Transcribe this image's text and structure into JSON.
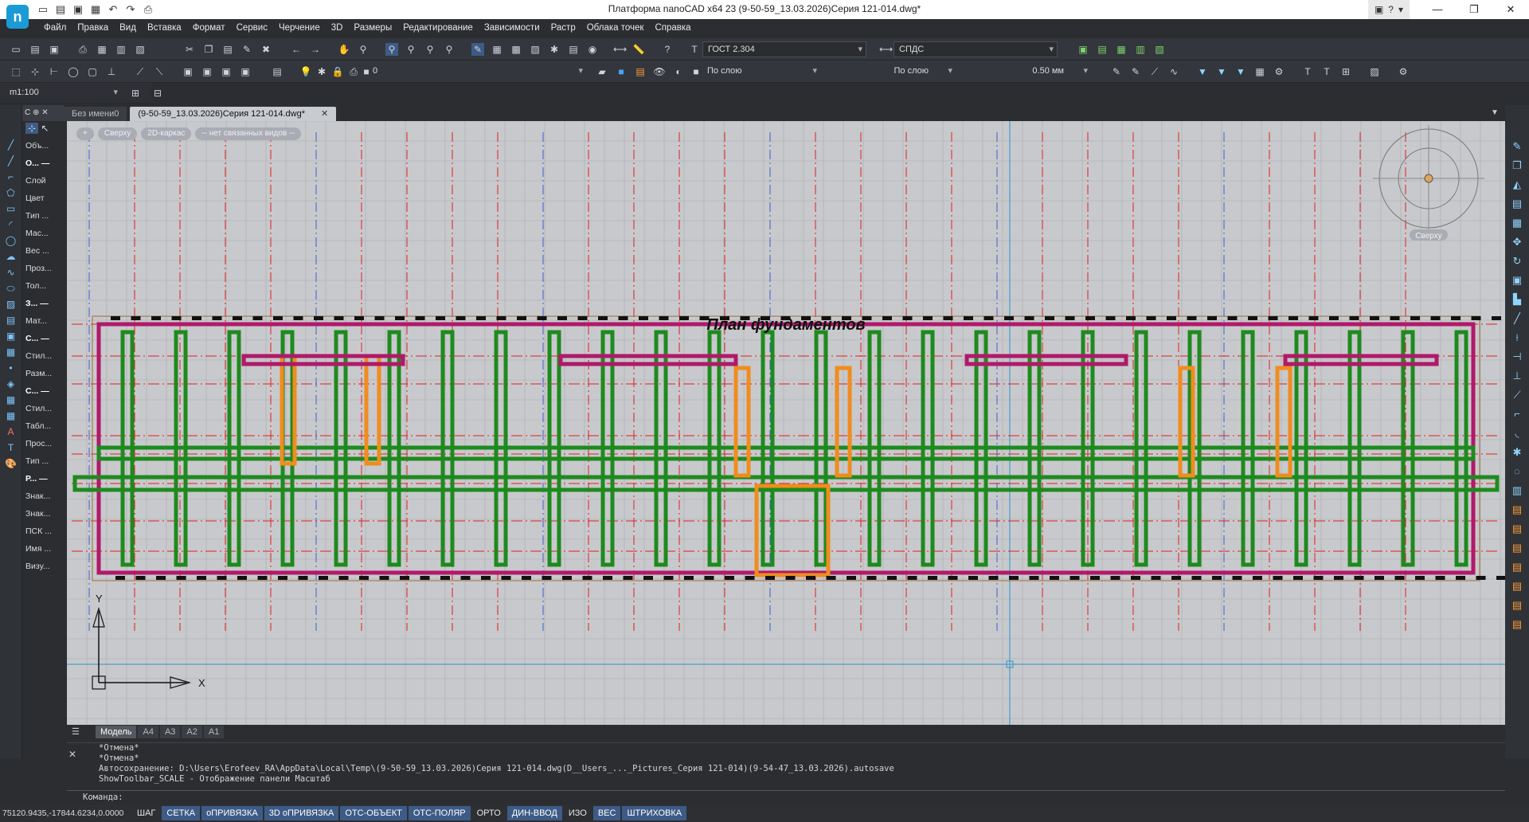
{
  "app": {
    "title": "Платформа nanoCAD x64 23 (9-50-59_13.03.2026)Серия 121-014.dwg*",
    "logo": "n"
  },
  "menu": [
    "Файл",
    "Правка",
    "Вид",
    "Вставка",
    "Формат",
    "Сервис",
    "Черчение",
    "3D",
    "Размеры",
    "Редактирование",
    "Зависимости",
    "Растр",
    "Облака точек",
    "Справка"
  ],
  "toolbar": {
    "text_style": "ГОСТ 2.304",
    "dim_style": "СПДС",
    "layer": "0",
    "color": "По слою",
    "linetype": "По слою",
    "lineweight": "0.50 мм",
    "scale": "m1:100"
  },
  "properties_panel": {
    "header": "С",
    "rows": [
      "Объ...",
      "О... —",
      "Слой",
      "Цвет",
      "Тип ...",
      "Мас...",
      "Вес ...",
      "Проз...",
      "Тол...",
      "З... —",
      "Мат...",
      "С... —",
      "Стил...",
      "Разм...",
      "С... —",
      "Стил...",
      "Табл...",
      "Прос...",
      "Тип ...",
      "Р... —",
      "Знак...",
      "Знак...",
      "ПСК ...",
      "Имя ...",
      "Визу..."
    ]
  },
  "doc_tabs": [
    {
      "label": "Без имени0",
      "active": false
    },
    {
      "label": "(9-50-59_13.03.2026)Серия 121-014.dwg*",
      "active": true
    }
  ],
  "view_buttons": [
    "+",
    "Сверху",
    "2D-каркас",
    "-- нет связанных видов --"
  ],
  "drawing": {
    "title": "План фундаментов",
    "viewcube_label": "Сверху",
    "axis_x": "X",
    "axis_y": "Y"
  },
  "layout_tabs": [
    {
      "label": "Модель",
      "active": true
    },
    {
      "label": "А4",
      "active": false
    },
    {
      "label": "А3",
      "active": false
    },
    {
      "label": "А2",
      "active": false
    },
    {
      "label": "А1",
      "active": false
    }
  ],
  "command_history": [
    "*Отмена*",
    "*Отмена*",
    "Автосохранение: D:\\Users\\Erofeev_RA\\AppData\\Local\\Temp\\(9-50-59_13.03.2026)Серия 121-014.dwg(D__Users_..._Pictures_Серия 121-014)(9-54-47_13.03.2026).autosave",
    "ShowToolbar_SCALE - Отображение панели Масштаб"
  ],
  "command_prompt": "Команда:",
  "status": {
    "coords": "75120.9435,-17844.6234,0.0000",
    "toggles": [
      {
        "label": "ШАГ",
        "on": false
      },
      {
        "label": "СЕТКА",
        "on": true
      },
      {
        "label": "оПРИВЯЗКА",
        "on": true
      },
      {
        "label": "3D оПРИВЯЗКА",
        "on": true
      },
      {
        "label": "ОТС-ОБЪЕКТ",
        "on": true
      },
      {
        "label": "ОТС-ПОЛЯР",
        "on": true
      },
      {
        "label": "ОРТО",
        "on": false
      },
      {
        "label": "ДИН-ВВОД",
        "on": true
      },
      {
        "label": "ИЗО",
        "on": false
      },
      {
        "label": "ВЕС",
        "on": true
      },
      {
        "label": "ШТРИХОВКА",
        "on": true
      }
    ]
  },
  "colors": {
    "viewport_bg": "#c8c9cc",
    "grid": "#a9abb0",
    "magenta_wall": "#b0196a",
    "green_footing": "#1e8a1e",
    "orange_footing": "#f08c1e",
    "blue_outline": "#3c5fd1",
    "red_axis": "#e02020",
    "cyan_line": "#2a95c8"
  }
}
